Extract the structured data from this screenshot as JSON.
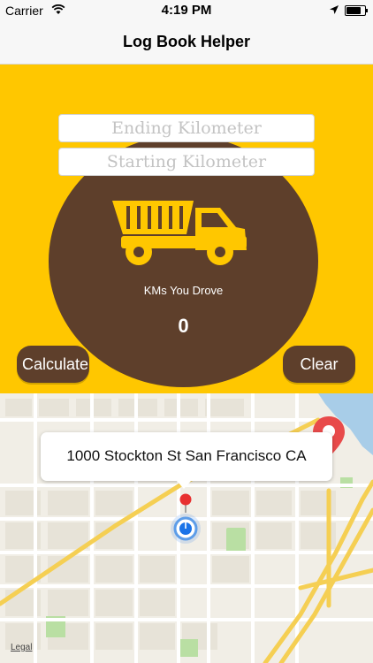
{
  "status_bar": {
    "carrier": "Carrier",
    "time": "4:19 PM",
    "battery_level": 0.8
  },
  "nav": {
    "title": "Log Book Helper"
  },
  "form": {
    "ending_placeholder": "Ending Kilometer",
    "starting_placeholder": "Starting Kilometer"
  },
  "result": {
    "label": "KMs You Drove",
    "value": "0"
  },
  "buttons": {
    "calculate": "Calculate",
    "clear": "Clear"
  },
  "map": {
    "address": "1000 Stockton St San Francisco CA",
    "legal": "Legal"
  },
  "colors": {
    "accent": "#ffc700",
    "brown": "#5e3f2b",
    "pin": "#e84a4a",
    "user_location": "#1a73e8"
  }
}
